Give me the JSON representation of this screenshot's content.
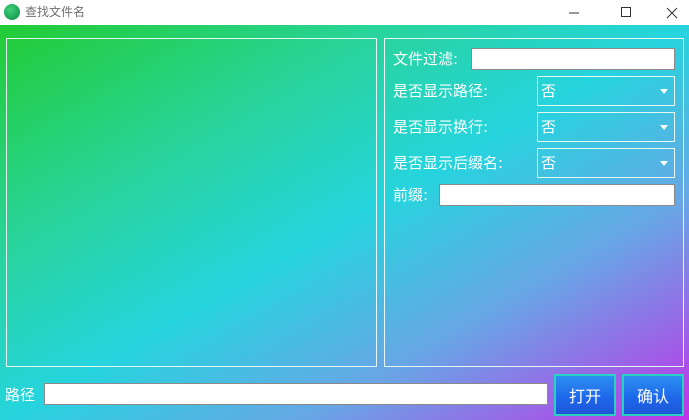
{
  "window": {
    "title": "查找文件名"
  },
  "options": {
    "filter_label": "文件过滤:",
    "filter_value": "",
    "show_path_label": "是否显示路径:",
    "show_path_value": "否",
    "show_newline_label": "是否显示换行:",
    "show_newline_value": "否",
    "show_suffix_label": "是否显示后缀名:",
    "show_suffix_value": "否",
    "prefix_label": "前缀:",
    "prefix_value": ""
  },
  "bottom": {
    "path_label": "路径",
    "path_value": "",
    "open_label": "打开",
    "confirm_label": "确认"
  },
  "colors": {
    "gradient_start": "#22cc33",
    "gradient_mid": "#26d4de",
    "gradient_end": "#c033e7",
    "button": "#1d66ea"
  }
}
